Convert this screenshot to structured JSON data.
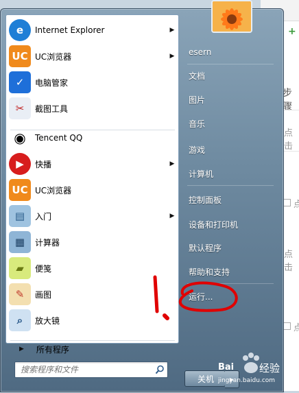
{
  "background_page": {
    "steps_text": "步骤",
    "click_text": "点击",
    "small_text": "点"
  },
  "programs": [
    {
      "label": "Internet Explorer",
      "icon": "internet-explorer-icon",
      "has_submenu": true
    },
    {
      "label": "UC浏览器",
      "icon": "uc-browser-icon",
      "has_submenu": true
    },
    {
      "label": "电脑管家",
      "icon": "pc-manager-icon",
      "has_submenu": false
    },
    {
      "label": "截图工具",
      "icon": "snipping-tool-icon",
      "has_submenu": false
    },
    {
      "label": "Tencent QQ",
      "icon": "qq-penguin-icon",
      "has_submenu": false
    },
    {
      "label": "快播",
      "icon": "qvod-icon",
      "has_submenu": true
    },
    {
      "label": "UC浏览器",
      "icon": "uc-browser-icon",
      "has_submenu": false
    },
    {
      "label": "入门",
      "icon": "getting-started-icon",
      "has_submenu": true
    },
    {
      "label": "计算器",
      "icon": "calculator-icon",
      "has_submenu": false
    },
    {
      "label": "便笺",
      "icon": "sticky-notes-icon",
      "has_submenu": false
    },
    {
      "label": "画图",
      "icon": "paint-icon",
      "has_submenu": false
    },
    {
      "label": "放大镜",
      "icon": "magnifier-icon",
      "has_submenu": false
    }
  ],
  "all_programs_label": "所有程序",
  "search_placeholder": "搜索程序和文件",
  "right_items": [
    {
      "label": "esern"
    },
    {
      "label": "文档"
    },
    {
      "label": "图片"
    },
    {
      "label": "音乐"
    },
    {
      "label": "游戏"
    },
    {
      "label": "计算机"
    },
    {
      "label": "控制面板"
    },
    {
      "label": "设备和打印机"
    },
    {
      "label": "默认程序"
    },
    {
      "label": "帮助和支持"
    },
    {
      "label": "运行..."
    }
  ],
  "shutdown_label": "关机",
  "annotation_text": "1.",
  "watermark": {
    "brand": "Bai",
    "suffix": "经验",
    "url": "jingyan.baidu.com"
  },
  "colors": {
    "annotation": "#e00000",
    "ie_blue": "#1f7fd6",
    "uc_orange": "#f08a1c"
  }
}
